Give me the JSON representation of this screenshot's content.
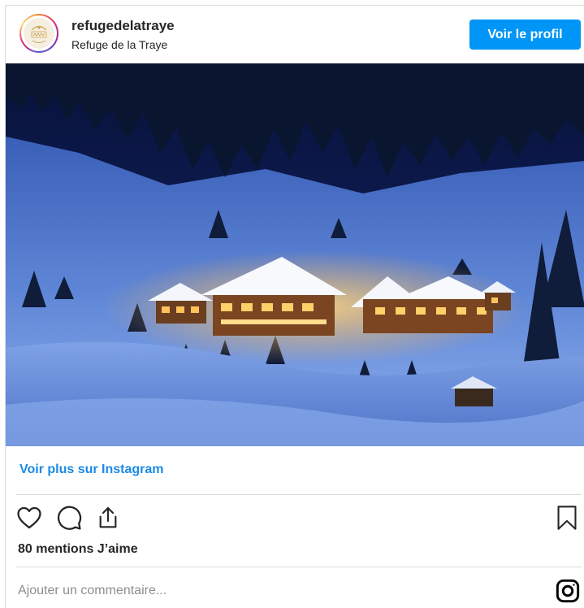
{
  "header": {
    "username": "refugedelatraye",
    "subname": "Refuge de la Traye",
    "profile_button": "Voir le profil"
  },
  "post": {
    "more_link": "Voir plus sur Instagram",
    "likes": "80 mentions J’aime",
    "comment_placeholder": "Ajouter un commentaire..."
  },
  "icons": {
    "like": "heart-icon",
    "comment": "comment-icon",
    "share": "share-icon",
    "save": "bookmark-icon",
    "brand": "instagram-icon"
  },
  "colors": {
    "button": "#0095f6",
    "link": "#1b8ae6"
  }
}
